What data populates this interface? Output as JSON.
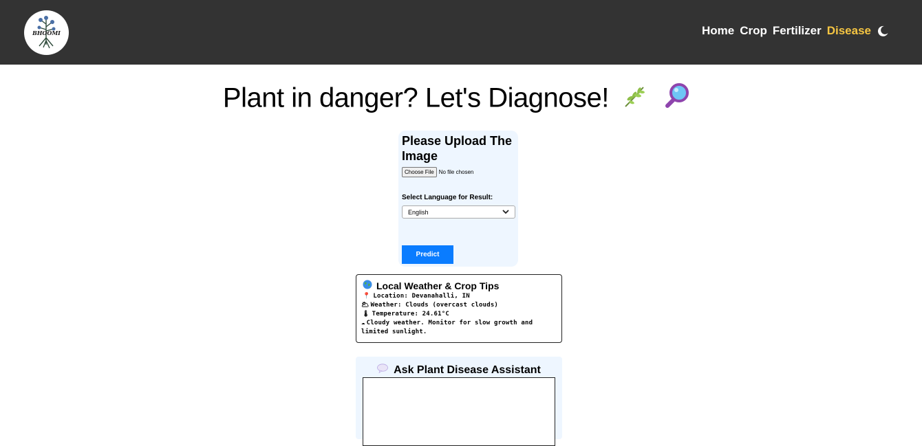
{
  "nav": {
    "logo_text": "BHOOMI",
    "links": [
      "Home",
      "Crop",
      "Fertilizer",
      "Disease"
    ],
    "active": "Disease",
    "active_color": "#f5c542",
    "theme_icon": "moon-icon"
  },
  "page": {
    "title": "Plant in danger? Let's Diagnose!",
    "title_icons": [
      "herb-icon",
      "magnifier-icon"
    ]
  },
  "upload": {
    "heading": "Please Upload The Image",
    "file_button": "Choose File",
    "file_status": "No file chosen",
    "language_label": "Select Language for Result:",
    "language_selected": "English",
    "predict_label": "Predict",
    "predict_color": "#0a7cff"
  },
  "weather": {
    "heading": "Local Weather & Crop Tips",
    "location": "Location: Devanahalli, IN",
    "condition": "Weather: Clouds (overcast clouds)",
    "temperature": "Temperature: 24.61°C",
    "tip": "Cloudy weather. Monitor for slow growth and limited sunlight."
  },
  "assistant": {
    "heading": "Ask Plant Disease Assistant"
  }
}
